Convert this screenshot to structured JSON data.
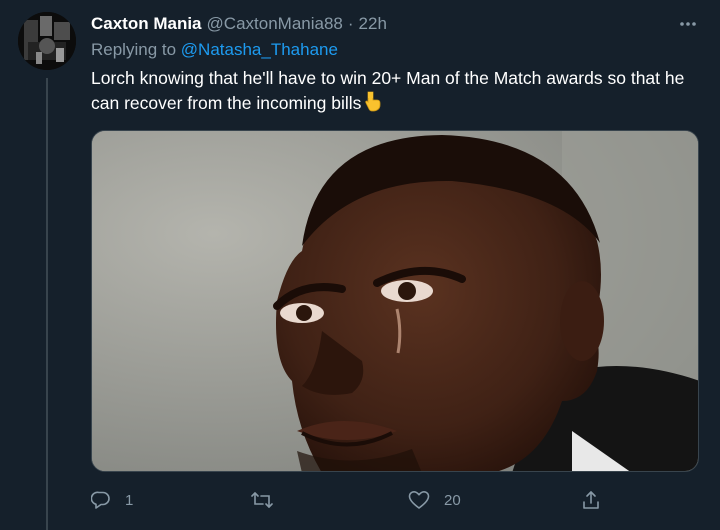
{
  "tweet": {
    "display_name": "Caxton Mania",
    "handle": "@CaxtonMania88",
    "separator": "·",
    "time": "22h",
    "replying_prefix": "Replying to",
    "replying_to": "@Natasha_Thahane",
    "text": "Lorch knowing that he'll have to win 20+ Man of the Match awards so that he can recover from the incoming bills",
    "emoji": "pointing-down-emoji"
  },
  "actions": {
    "reply_count": "1",
    "retweet_count": "",
    "like_count": "20",
    "share_count": ""
  },
  "icons": {
    "more": "more-horizontal-icon",
    "reply": "reply-icon",
    "retweet": "retweet-icon",
    "like": "heart-icon",
    "share": "share-icon"
  },
  "colors": {
    "background": "#15202b",
    "secondary_text": "#8899a6",
    "link": "#1d9bf0",
    "border": "#38444d"
  }
}
